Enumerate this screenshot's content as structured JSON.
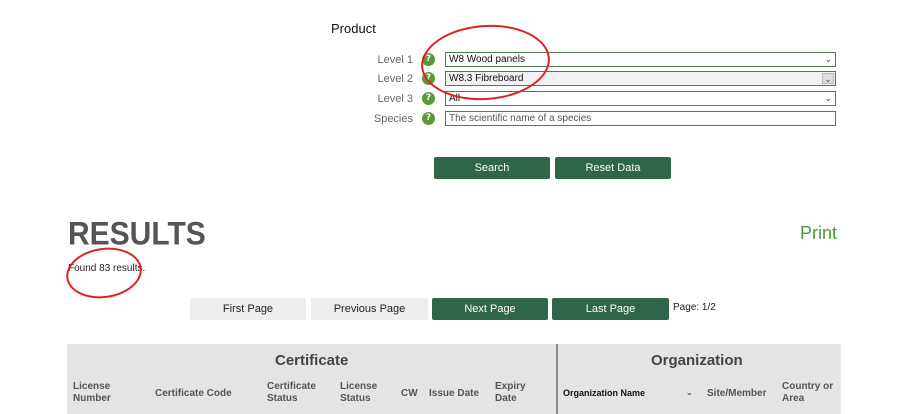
{
  "product": {
    "title": "Product",
    "fields": [
      {
        "label": "Level 1",
        "value": "W8 Wood panels"
      },
      {
        "label": "Level 2",
        "value": "W8.3 Fibreboard"
      },
      {
        "label": "Level 3",
        "value": "All"
      },
      {
        "label": "Species",
        "placeholder": "The scientific name of a species"
      }
    ],
    "help_glyph": "?"
  },
  "actions": {
    "search_label": "Search",
    "reset_label": "Reset Data"
  },
  "results": {
    "title": "RESULTS",
    "print_label": "Print",
    "found_text": "Found 83 results.",
    "page_info": "Page: 1/2"
  },
  "pagination": {
    "first": "First Page",
    "previous": "Previous Page",
    "next": "Next Page",
    "last": "Last Page"
  },
  "table": {
    "groups": {
      "certificate": "Certificate",
      "organization": "Organization"
    },
    "columns": {
      "license_number": "License Number",
      "certificate_code": "Certificate Code",
      "certificate_status": "Certificate Status",
      "license_status": "License Status",
      "cw": "CW",
      "issue_date": "Issue Date",
      "expiry_date": "Expiry Date",
      "organization_name": "Organization Name",
      "site_member": "Site/Member",
      "country_area": "Country or Area"
    }
  },
  "colors": {
    "accent_green": "#2f6647",
    "print_green": "#4c9a3b",
    "annotation_red": "#dd2222"
  },
  "icons": {
    "help": "question-circle-icon",
    "dropdown": "chevron-down-icon"
  }
}
